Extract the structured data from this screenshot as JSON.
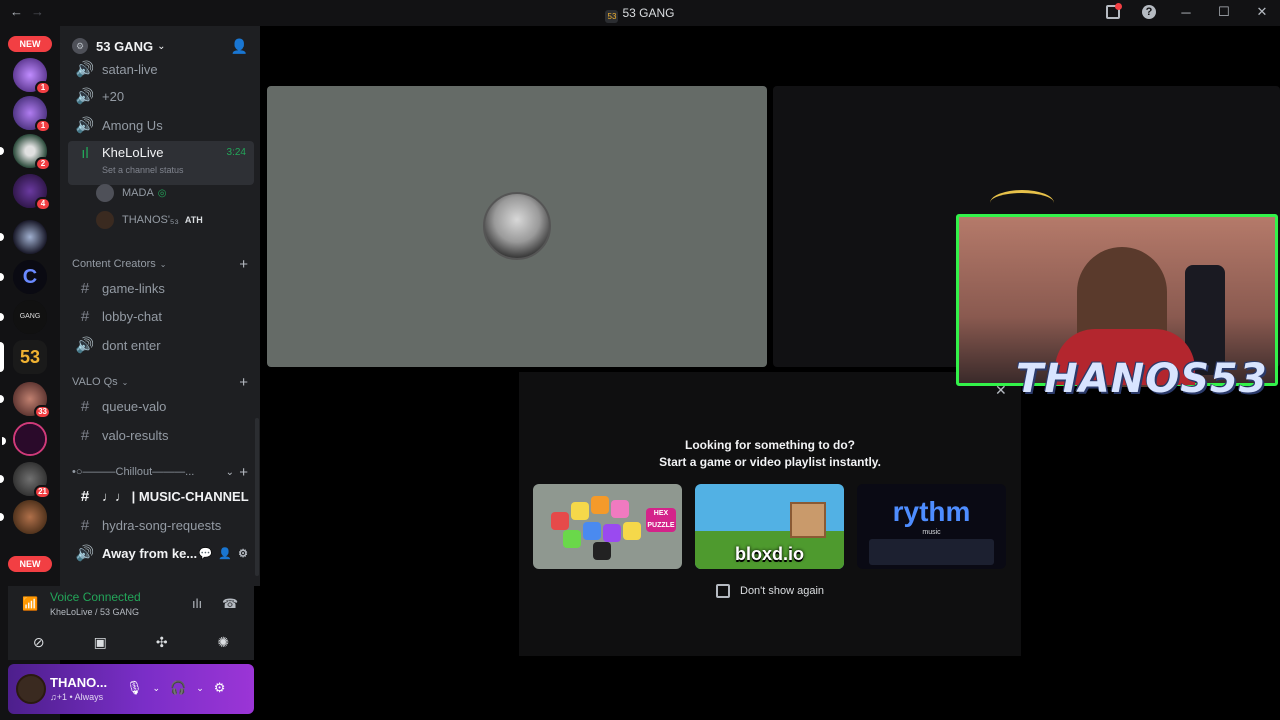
{
  "titlebar": {
    "title": "53 GANG",
    "server_mini_icon": "53",
    "nav": {
      "back": "←",
      "forward": "→"
    },
    "controls": {
      "minimize": "─",
      "maximize": "☐",
      "close": "✕",
      "help": "?"
    }
  },
  "rail": {
    "new_label_top": "NEW",
    "new_label_bottom": "NEW",
    "servers": [
      {
        "badge": "1"
      },
      {
        "badge": "1"
      },
      {
        "badge": "2"
      },
      {
        "badge": "4"
      },
      {
        "badge": ""
      },
      {
        "badge": ""
      },
      {
        "badge": ""
      },
      {
        "badge": ""
      },
      {
        "badge": "33"
      },
      {
        "badge": ""
      },
      {
        "badge": "21"
      },
      {
        "badge": ""
      }
    ],
    "server_text": {
      "gang": "GANG",
      "fiftythree": "53"
    }
  },
  "server": {
    "name": "53 GANG",
    "caret": "⌄"
  },
  "channels": {
    "satan_live": "satan-live",
    "plus20": "+20",
    "among_us": "Among Us",
    "khelolive": "KheLoLive",
    "khelolive_timer": "3:24",
    "khelolive_status": "Set a channel status",
    "voice_users": [
      {
        "name": "MADA",
        "game": "◎"
      },
      {
        "name": "THANOS'₅₃",
        "tag": "ATH"
      }
    ],
    "cat_content": "Content Creators",
    "game_links": "game-links",
    "lobby_chat": "lobby-chat",
    "dont_enter": "dont enter",
    "cat_valo": "VALO Qs",
    "queue_valo": "queue-valo",
    "valo_results": "valo-results",
    "cat_chillout": "•○———Chillout———...",
    "music_channel": "♩♩ | MUSIC-CHANNEL",
    "hydra": "hydra-song-requests",
    "away": "Away from ke..."
  },
  "voice_panel": {
    "status": "Voice Connected",
    "sub": "KheLoLive / 53 GANG"
  },
  "user_panel": {
    "name": "THANO...",
    "sub": "♫+1 • Always"
  },
  "activity_panel": {
    "question": "Looking for something to do?",
    "subtitle": "Start a game or video playlist instantly.",
    "activities": [
      {
        "label": "",
        "tag": "HEX PUZZLE"
      },
      {
        "label": "bloxd.io"
      },
      {
        "label": "rythm",
        "sub": "music"
      }
    ],
    "dont_show": "Don't show again"
  },
  "webcam": {
    "overlay_name": "THANOS53"
  },
  "colors": {
    "voice_green": "#23a559",
    "cam_border": "#33f24a",
    "danger": "#f23f43",
    "blurple": "#5865f2"
  }
}
